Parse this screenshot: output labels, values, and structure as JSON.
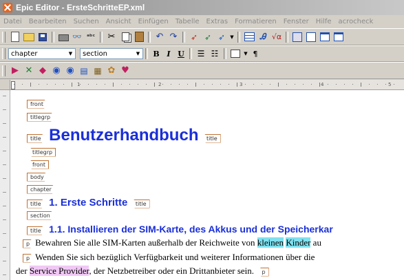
{
  "window": {
    "title": "Epic Editor - ErsteSchritteEP.xml"
  },
  "menu": [
    "Datei",
    "Bearbeiten",
    "Suchen",
    "Ansicht",
    "Einfügen",
    "Tabelle",
    "Extras",
    "Formatieren",
    "Fenster",
    "Hilfe",
    "acrocheck"
  ],
  "toolbar": {
    "element_combo": "chapter",
    "section_combo": "section",
    "bold": "B",
    "italic": "I",
    "underline": "U",
    "pilcrow": "¶"
  },
  "colors": {
    "heading": "#1a2fd8",
    "tag_border": "#c07030",
    "highlight_cyan": "#7fe0ee",
    "highlight_pink": "#f0c8f4"
  },
  "ruler": [
    "1",
    "2",
    "3",
    "4",
    "5"
  ],
  "document": {
    "tags": {
      "front": "front",
      "titlegrp": "titlegrp",
      "title": "title",
      "body": "body",
      "chapter": "chapter",
      "section": "section",
      "p": "p"
    },
    "book_title": "Benutzerhandbuch",
    "chapter_title": "1. Erste Schritte",
    "section_title": "1.1. Installieren der SIM-Karte, des Akkus und der Speicherkar",
    "p1_before": "Bewahren Sie alle SIM-Karten außerhalb der Reichweite von ",
    "p1_hl1": "kleinen",
    "p1_hl2": "Kinder",
    "p1_after": " au",
    "p2_line1": "Wenden Sie sich bezüglich Verfügbarkeit und weiterer Informationen über die",
    "p2_line2_before": "der ",
    "p2_hl": "Service Provider",
    "p2_line2_after": ", der Netzbetreiber oder ein Drittanbieter sein."
  }
}
